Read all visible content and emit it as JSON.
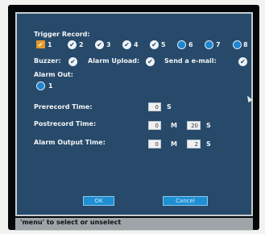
{
  "trigger_record": {
    "label": "Trigger Record:",
    "channels": [
      "1",
      "2",
      "3",
      "4",
      "5",
      "6",
      "7",
      "8"
    ]
  },
  "buzzer": {
    "label": "Buzzer:"
  },
  "alarm_upload": {
    "label": "Alarm Upload:"
  },
  "send_email": {
    "label": "Send a e-mail:"
  },
  "alarm_out": {
    "label": "Alarm Out:",
    "channel": "1"
  },
  "prerecord": {
    "label": "Prerecord Time:",
    "value": "0",
    "unit": "S"
  },
  "postrecord": {
    "label": "Postrecord Time:",
    "minutes": "0",
    "minutes_unit": "M",
    "seconds": "20",
    "seconds_unit": "S"
  },
  "alarm_output_time": {
    "label": "Alarm Output Time:",
    "minutes": "0",
    "minutes_unit": "M",
    "seconds": "2",
    "seconds_unit": "S"
  },
  "buttons": {
    "ok": "OK",
    "cancel": "Cancel"
  },
  "status_bar": {
    "hint": "'menu' to select or unselect"
  },
  "icons": {
    "checkbox": "check-icon",
    "selected_checkbox": "orange-check-icon",
    "radio": "radio-dot-icon",
    "cursor": "mouse-pointer-icon"
  },
  "colors": {
    "panel": "#274a6a",
    "accent": "#1e8fd2",
    "highlight": "#e49a2a"
  }
}
